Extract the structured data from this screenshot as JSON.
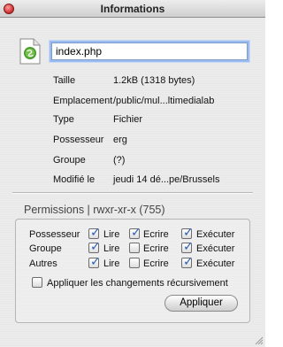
{
  "window": {
    "title": "Informations"
  },
  "file": {
    "name": "index.php",
    "icon": "php-file-icon"
  },
  "info_rows": [
    {
      "label": "Taille",
      "value": "1.2kB (1318 bytes)"
    },
    {
      "label": "Emplacement",
      "value": "/public/mul...ltimedialab"
    },
    {
      "label": "Type",
      "value": "Fichier"
    },
    {
      "label": "Possesseur",
      "value": "erg"
    },
    {
      "label": "Groupe",
      "value": "(?)"
    },
    {
      "label": "Modifié le",
      "value": "jeudi 14 dé...pe/Brussels"
    }
  ],
  "permissions": {
    "header": "Permissions | rwxr-xr-x (755)",
    "columns": [
      "Lire",
      "Ecrire",
      "Exécuter"
    ],
    "rows": [
      {
        "label": "Possesseur",
        "read": true,
        "write": true,
        "execute": true
      },
      {
        "label": "Groupe",
        "read": true,
        "write": false,
        "execute": true
      },
      {
        "label": "Autres",
        "read": true,
        "write": false,
        "execute": true
      }
    ],
    "recursive_label": "Appliquer les changements récursivement",
    "recursive_checked": false,
    "apply_label": "Appliquer"
  },
  "colors": {
    "checkmark": "#2d5fb5",
    "focus_ring": "#9bbcf0"
  }
}
